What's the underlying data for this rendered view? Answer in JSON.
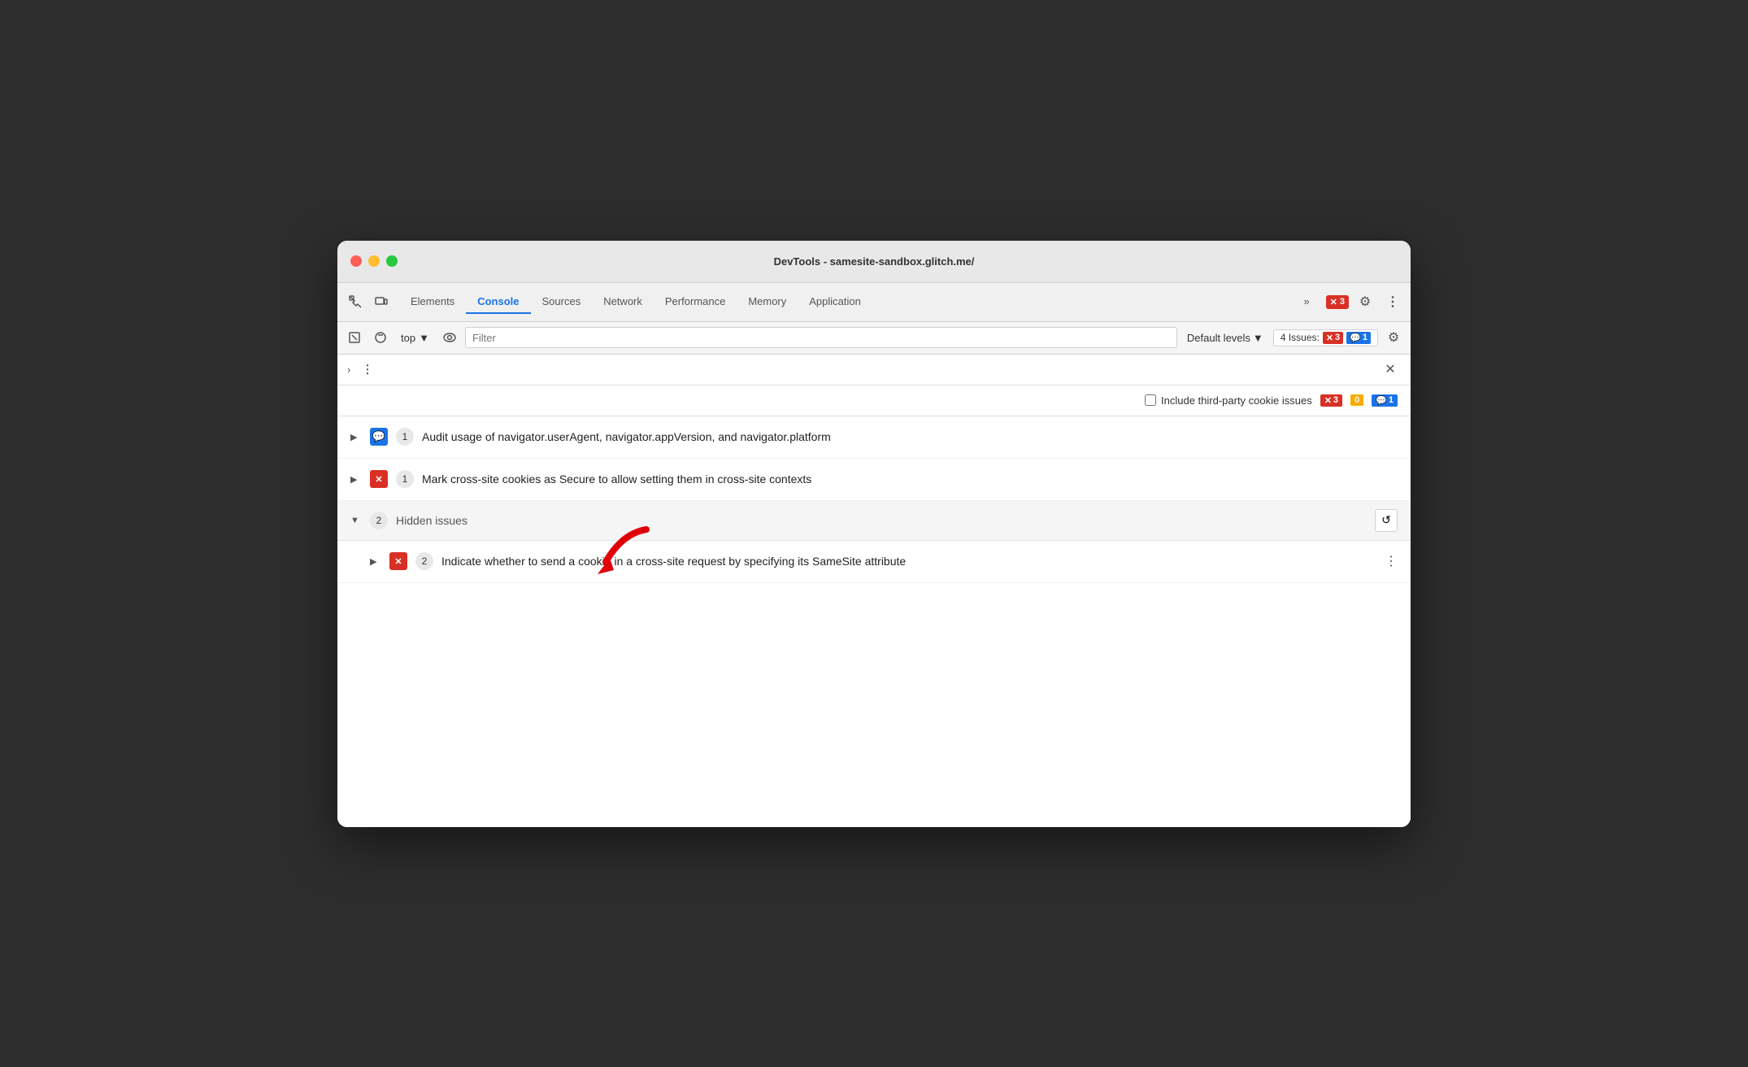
{
  "window": {
    "title": "DevTools - samesite-sandbox.glitch.me/"
  },
  "tabs": [
    {
      "label": "Elements",
      "active": false
    },
    {
      "label": "Console",
      "active": true
    },
    {
      "label": "Sources",
      "active": false
    },
    {
      "label": "Network",
      "active": false
    },
    {
      "label": "Performance",
      "active": false
    },
    {
      "label": "Memory",
      "active": false
    },
    {
      "label": "Application",
      "active": false
    }
  ],
  "tabbar": {
    "error_count": "3",
    "more_label": "»"
  },
  "toolbar": {
    "top_label": "top",
    "filter_placeholder": "Filter",
    "default_levels_label": "Default levels",
    "issues_label": "4 Issues:",
    "error_count": "3",
    "info_count": "1"
  },
  "content_header": {
    "menu_dots": "⋮",
    "close_label": "✕"
  },
  "third_party": {
    "checkbox_label": "Include third-party cookie issues",
    "error_count": "3",
    "warning_count": "0",
    "info_count": "1"
  },
  "issues": [
    {
      "id": "issue-1",
      "type": "info",
      "count": "1",
      "text": "Audit usage of navigator.userAgent, navigator.appVersion, and navigator.platform"
    },
    {
      "id": "issue-2",
      "type": "error",
      "count": "1",
      "text": "Mark cross-site cookies as Secure to allow setting them in cross-site contexts"
    }
  ],
  "hidden_issues": {
    "count": "2",
    "label": "Hidden issues",
    "refresh_icon": "↺"
  },
  "sub_issue": {
    "type": "error",
    "count": "2",
    "text": "Indicate whether to send a cookie in a cross-site request by specifying its SameSite attribute"
  }
}
